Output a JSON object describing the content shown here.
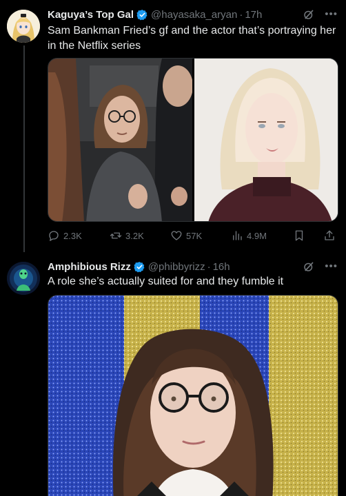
{
  "tweet1": {
    "display_name": "Kaguya’s Top Gal",
    "handle": "@hayasaka_aryan",
    "time": "17h",
    "text": "Sam Bankman Fried’s gf and the actor that’s portraying her in the Netflix series",
    "stats": {
      "replies": "2.3K",
      "reposts": "3.2K",
      "likes": "57K",
      "views": "4.9M"
    }
  },
  "tweet2": {
    "display_name": "Amphibious Rizz",
    "handle": "@phibbyrizz",
    "time": "16h",
    "text": "A role she’s actually suited for and they fumble it"
  },
  "colors": {
    "verified": "#1d9bf0",
    "muted": "#71767b",
    "text": "#e7e9ea",
    "background": "#000000"
  },
  "icons": [
    "verified-icon",
    "grok-icon",
    "more-icon",
    "reply-icon",
    "repost-icon",
    "like-icon",
    "views-icon",
    "bookmark-icon",
    "share-icon"
  ]
}
